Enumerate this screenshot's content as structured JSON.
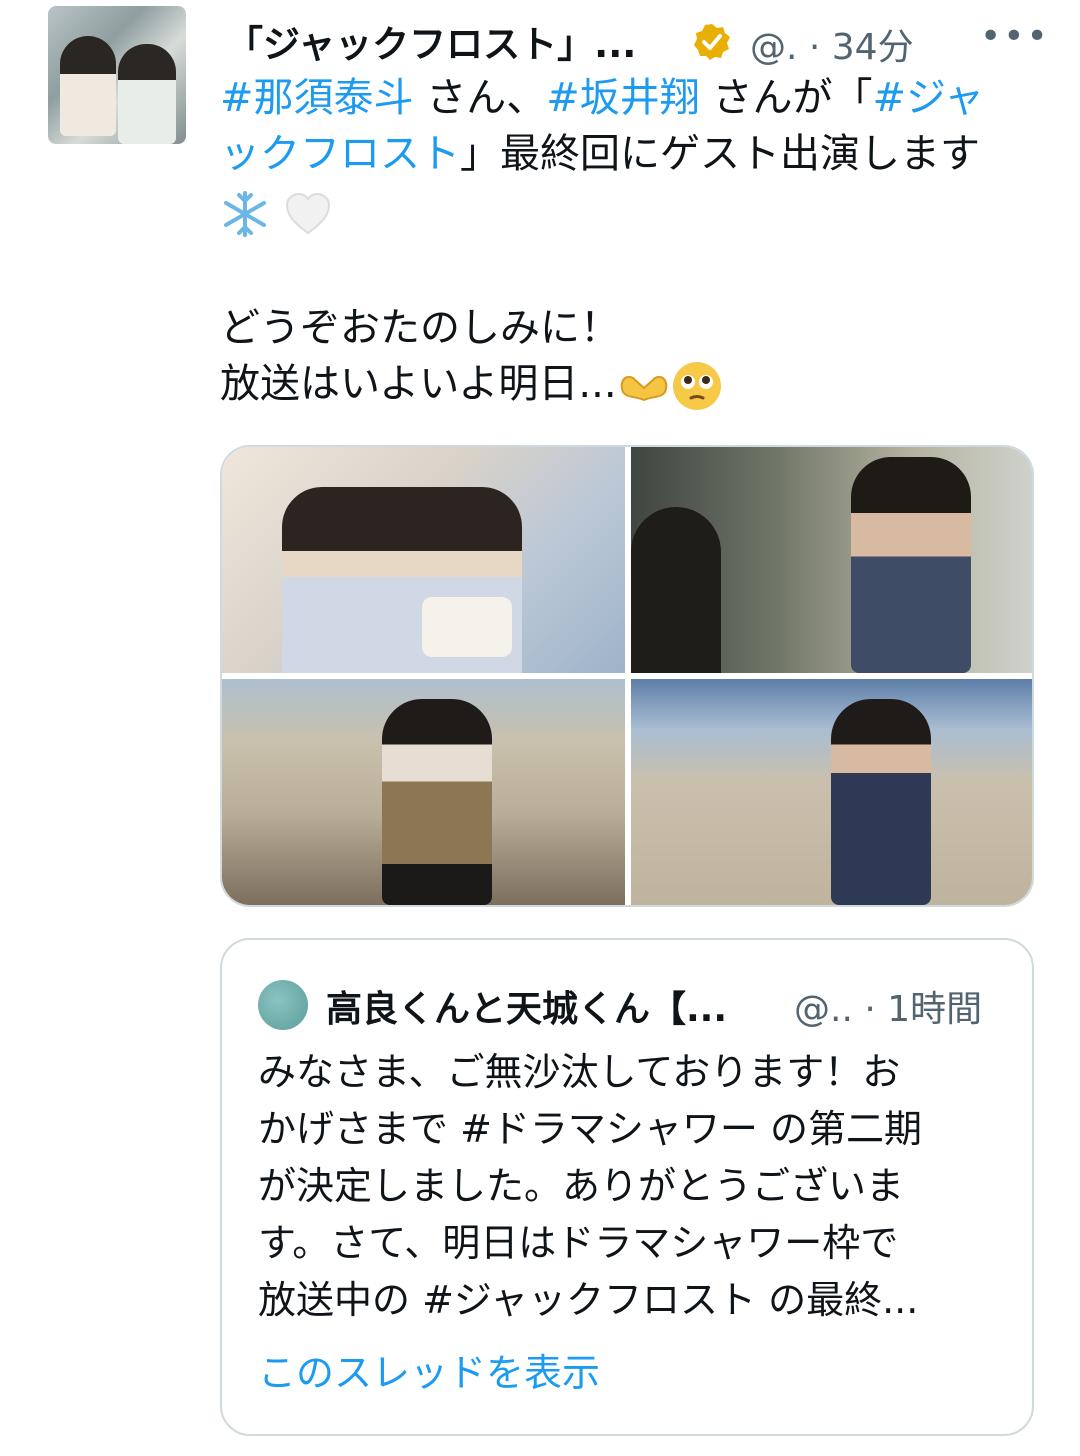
{
  "tweet": {
    "display_name": "「ジャックフロスト」...",
    "handle_time": "@. · 34分",
    "more": "•••",
    "text": {
      "line1_tag1": "#那須泰斗",
      "line1_mid": " さん、",
      "line1_tag2": "#坂井翔",
      "line1_end": " さんが「",
      "line1_tag3": "#ジャ",
      "line2_tag": "ックフロスト",
      "line2_end": "」最終回にゲスト出演します",
      "line4": "どうぞおたのしみに！",
      "line5": "放送はいよいよ明日..."
    },
    "accent": "#1d9bf0",
    "verified_color": "#e8b004"
  },
  "quoted": {
    "display_name": "高良くんと天城くん【...",
    "handle_time": "@.. · 1時間",
    "lines": [
      "みなさま、ご無沙汰しております！お",
      "かげさまで #ドラマシャワー の第二期",
      "が決定しました。ありがとうございま",
      "す。さて、明日はドラマシャワー枠で",
      "放送中の #ジャックフロスト の最終..."
    ],
    "show_thread": "このスレッドを表示"
  }
}
